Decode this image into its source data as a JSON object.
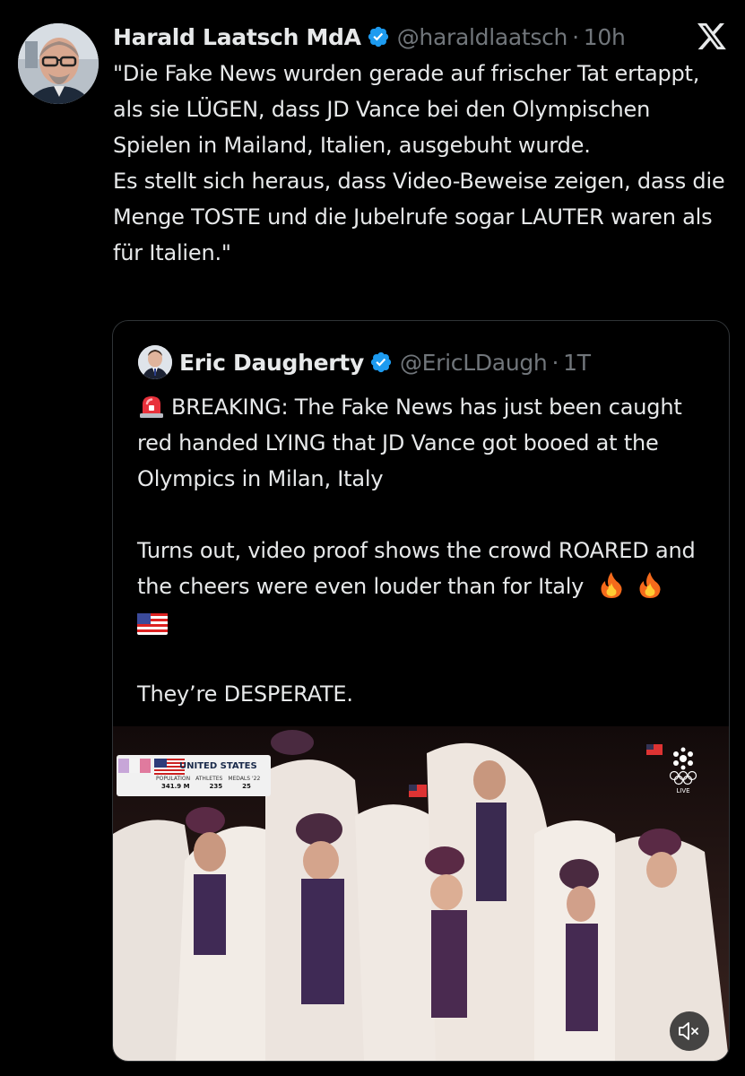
{
  "tweet": {
    "author_name": "Harald Laatsch MdA",
    "handle": "@haraldlaatsch",
    "separator": "·",
    "time": "10h",
    "paragraphs": [
      "\"Die Fake News wurden gerade auf frischer Tat ertappt, als sie LÜGEN, dass JD Vance bei den Olympischen Spielen in Mailand, Italien, ausgebuht wurde.",
      "Es stellt sich heraus, dass Video-Beweise zeigen, dass die Menge TOSTE und die Jubelrufe sogar LAUTER waren als für Italien.\""
    ]
  },
  "quoted": {
    "author_name": "Eric Daugherty",
    "handle": "@EricLDaugh",
    "separator": "·",
    "time": "1T",
    "line1": "BREAKING: The Fake News has just been caught red handed LYING that JD Vance got booed at the Olympics in Milan, Italy",
    "line2": "Turns out, video proof shows the crowd ROARED and the cheers were even louder than for Italy",
    "line3": "They’re DESPERATE."
  },
  "video": {
    "overlay": {
      "country": "UNITED STATES",
      "labels": [
        "POPULATION",
        "ATHLETES",
        "MEDALS '22"
      ],
      "values": [
        "341.9 M",
        "235",
        "25"
      ]
    },
    "broadcaster_tag": "LIVE"
  },
  "icons": {
    "verified": "verified-badge-icon",
    "x_logo": "x-logo-icon",
    "siren": "siren-emoji-icon",
    "fire": "fire-emoji-icon",
    "us_flag": "us-flag-emoji-icon",
    "mute": "speaker-muted-icon"
  },
  "colors": {
    "background": "#000000",
    "text": "#e7e9ea",
    "secondary": "#71767b",
    "verified": "#1d9bf0",
    "border": "#2f3336"
  }
}
